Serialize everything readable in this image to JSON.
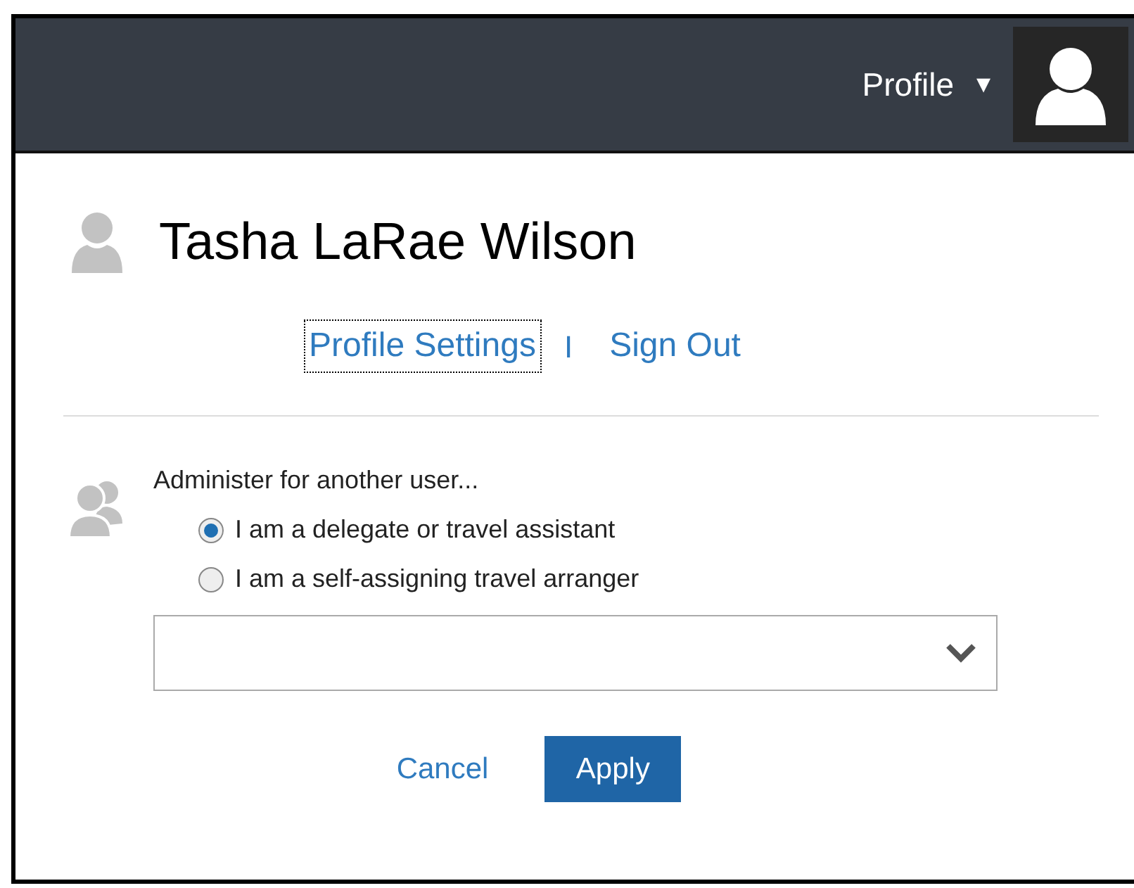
{
  "navbar": {
    "menu_label": "Profile",
    "menu_caret": "▾"
  },
  "user": {
    "name": "Tasha LaRae Wilson"
  },
  "links": [
    {
      "label": "Profile Settings",
      "focused": true
    },
    {
      "label": "Sign Out",
      "focused": false
    }
  ],
  "link_separator": "I",
  "administer": {
    "label": "Administer for another user...",
    "options": [
      {
        "label": "I am a delegate or travel assistant",
        "selected": true
      },
      {
        "label": "I am a self-assigning travel arranger",
        "selected": false
      }
    ]
  },
  "buttons": [
    {
      "label": "Cancel",
      "kind": "link"
    },
    {
      "label": "Apply",
      "kind": "primary"
    }
  ]
}
